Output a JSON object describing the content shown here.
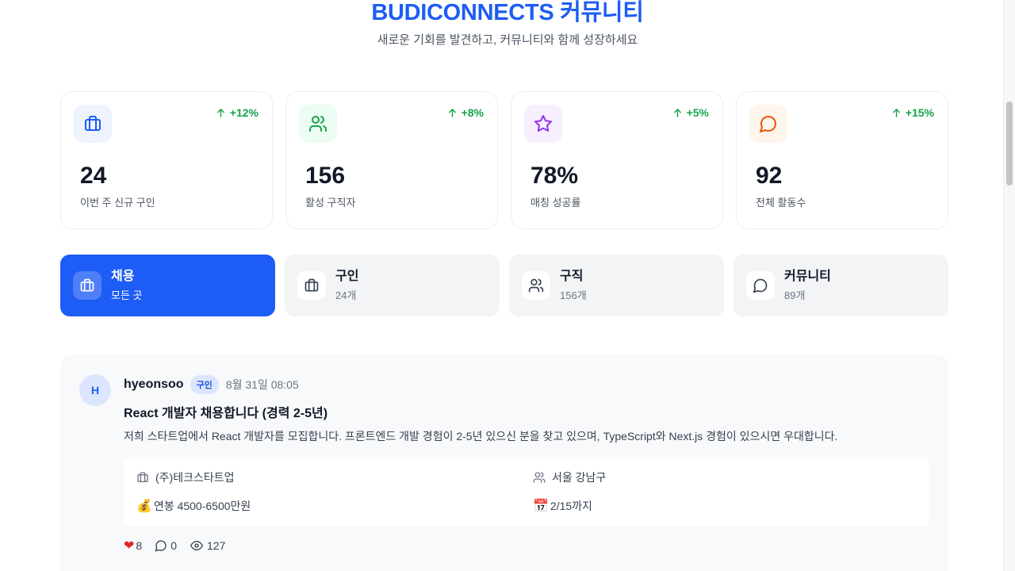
{
  "header": {
    "title": "BUDICONNECTS 커뮤니티",
    "subtitle": "새로운 기회를 발견하고, 커뮤니티와 함께 성장하세요"
  },
  "stats": [
    {
      "change": "+12%",
      "value": "24",
      "label": "이번 주 신규 구인",
      "icon": "briefcase-icon",
      "color": "#1d5cf5",
      "bg": "#eef3fe"
    },
    {
      "change": "+8%",
      "value": "156",
      "label": "활성 구직자",
      "icon": "users-icon",
      "color": "#16a34a",
      "bg": "#ecfdf3"
    },
    {
      "change": "+5%",
      "value": "78%",
      "label": "매칭 성공률",
      "icon": "star-icon",
      "color": "#9333ea",
      "bg": "#f7effe"
    },
    {
      "change": "+15%",
      "value": "92",
      "label": "전체 활동수",
      "icon": "message-circle-icon",
      "color": "#ea580c",
      "bg": "#fef5ec"
    }
  ],
  "tabs": [
    {
      "title": "채용",
      "sub": "모든 곳",
      "active": true
    },
    {
      "title": "구인",
      "sub": "24개"
    },
    {
      "title": "구직",
      "sub": "156개"
    },
    {
      "title": "커뮤니티",
      "sub": "89개"
    }
  ],
  "post": {
    "avatar_initial": "H",
    "author": "hyeonsoo",
    "badge": "구인",
    "time": "8월 31일 08:05",
    "title": "React 개발자 채용합니다 (경력 2-5년)",
    "body": "저희 스타트업에서 React 개발자를 모집합니다. 프론트엔드 개발 경험이 2-5년 있으신 분을 찾고 있으며, TypeScript와 Next.js 경험이 있으시면 우대합니다.",
    "company": "(주)테크스타트업",
    "location": "서울 강남구",
    "salary": "연봉 4500-6500만원",
    "deadline": "2/15까지",
    "likes": "8",
    "comments": "0",
    "views": "127"
  },
  "colors": {
    "accent": "#1d5cf5",
    "positive": "#16a34a"
  }
}
